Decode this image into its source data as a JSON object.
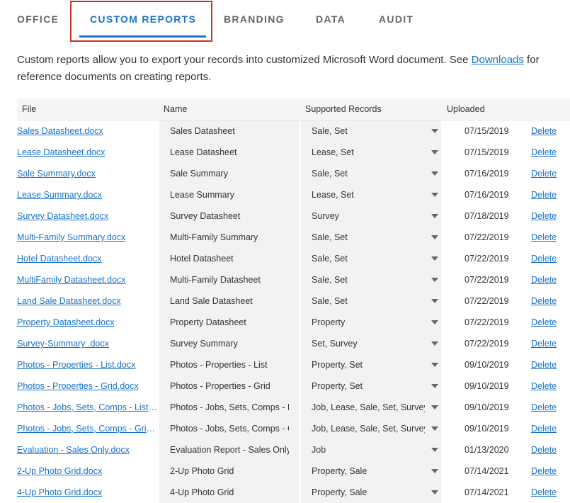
{
  "tabs": [
    {
      "label": "OFFICE"
    },
    {
      "label": "CUSTOM REPORTS"
    },
    {
      "label": "BRANDING"
    },
    {
      "label": "DATA"
    },
    {
      "label": "AUDIT"
    }
  ],
  "intro": {
    "text_before": "Custom reports allow you to export your records into customized Microsoft Word document. See ",
    "link": "Downloads",
    "text_after": " for reference documents on creating reports."
  },
  "table": {
    "headers": {
      "file": "File",
      "name": "Name",
      "records": "Supported Records",
      "uploaded": "Uploaded"
    },
    "delete_label": "Delete",
    "rows": [
      {
        "file": "Sales Datasheet.docx",
        "name": "Sales Datasheet",
        "records": "Sale, Set",
        "uploaded": "07/15/2019"
      },
      {
        "file": "Lease Datasheet.docx",
        "name": "Lease Datasheet",
        "records": "Lease, Set",
        "uploaded": "07/15/2019"
      },
      {
        "file": "Sale Summary.docx",
        "name": "Sale Summary",
        "records": "Sale, Set",
        "uploaded": "07/16/2019"
      },
      {
        "file": "Lease Summary.docx",
        "name": "Lease Summary",
        "records": "Lease, Set",
        "uploaded": "07/16/2019"
      },
      {
        "file": "Survey Datasheet.docx",
        "name": "Survey Datasheet",
        "records": "Survey",
        "uploaded": "07/18/2019"
      },
      {
        "file": "Multi-Family Summary.docx",
        "name": "Multi-Family Summary",
        "records": "Sale, Set",
        "uploaded": "07/22/2019"
      },
      {
        "file": "Hotel Datasheet.docx",
        "name": "Hotel Datasheet",
        "records": "Sale, Set",
        "uploaded": "07/22/2019"
      },
      {
        "file": "MultiFamily Datasheet.docx",
        "name": "Multi-Family Datasheet",
        "records": "Sale, Set",
        "uploaded": "07/22/2019"
      },
      {
        "file": "Land Sale Datasheet.docx",
        "name": "Land Sale Datasheet",
        "records": "Sale, Set",
        "uploaded": "07/22/2019"
      },
      {
        "file": "Property Datasheet.docx",
        "name": "Property Datasheet",
        "records": "Property",
        "uploaded": "07/22/2019"
      },
      {
        "file": "Survey-Summary .docx",
        "name": "Survey Summary",
        "records": "Set, Survey",
        "uploaded": "07/22/2019"
      },
      {
        "file": "Photos - Properties - List.docx",
        "name": "Photos - Properties - List",
        "records": "Property, Set",
        "uploaded": "09/10/2019"
      },
      {
        "file": "Photos - Properties - Grid.docx",
        "name": "Photos - Properties - Grid",
        "records": "Property, Set",
        "uploaded": "09/10/2019"
      },
      {
        "file": "Photos - Jobs, Sets, Comps - List.docx",
        "name": "Photos - Jobs, Sets, Comps - List",
        "records": "Job, Lease, Sale, Set, Survey",
        "uploaded": "09/10/2019"
      },
      {
        "file": "Photos - Jobs, Sets, Comps - Grid.docx",
        "name": "Photos - Jobs, Sets, Comps - Grid",
        "records": "Job, Lease, Sale, Set, Survey",
        "uploaded": "09/10/2019"
      },
      {
        "file": "Evaluation - Sales Only.docx",
        "name": "Evaluation Report - Sales Only",
        "records": "Job",
        "uploaded": "01/13/2020"
      },
      {
        "file": "2-Up Photo Grid.docx",
        "name": "2-Up Photo Grid",
        "records": "Property, Sale",
        "uploaded": "07/14/2021"
      },
      {
        "file": "4-Up Photo Grid.docx",
        "name": "4-Up Photo Grid",
        "records": "Property, Sale",
        "uploaded": "07/14/2021"
      }
    ]
  },
  "colors": {
    "accent": "#1a73c8",
    "highlight": "#d0312d"
  }
}
